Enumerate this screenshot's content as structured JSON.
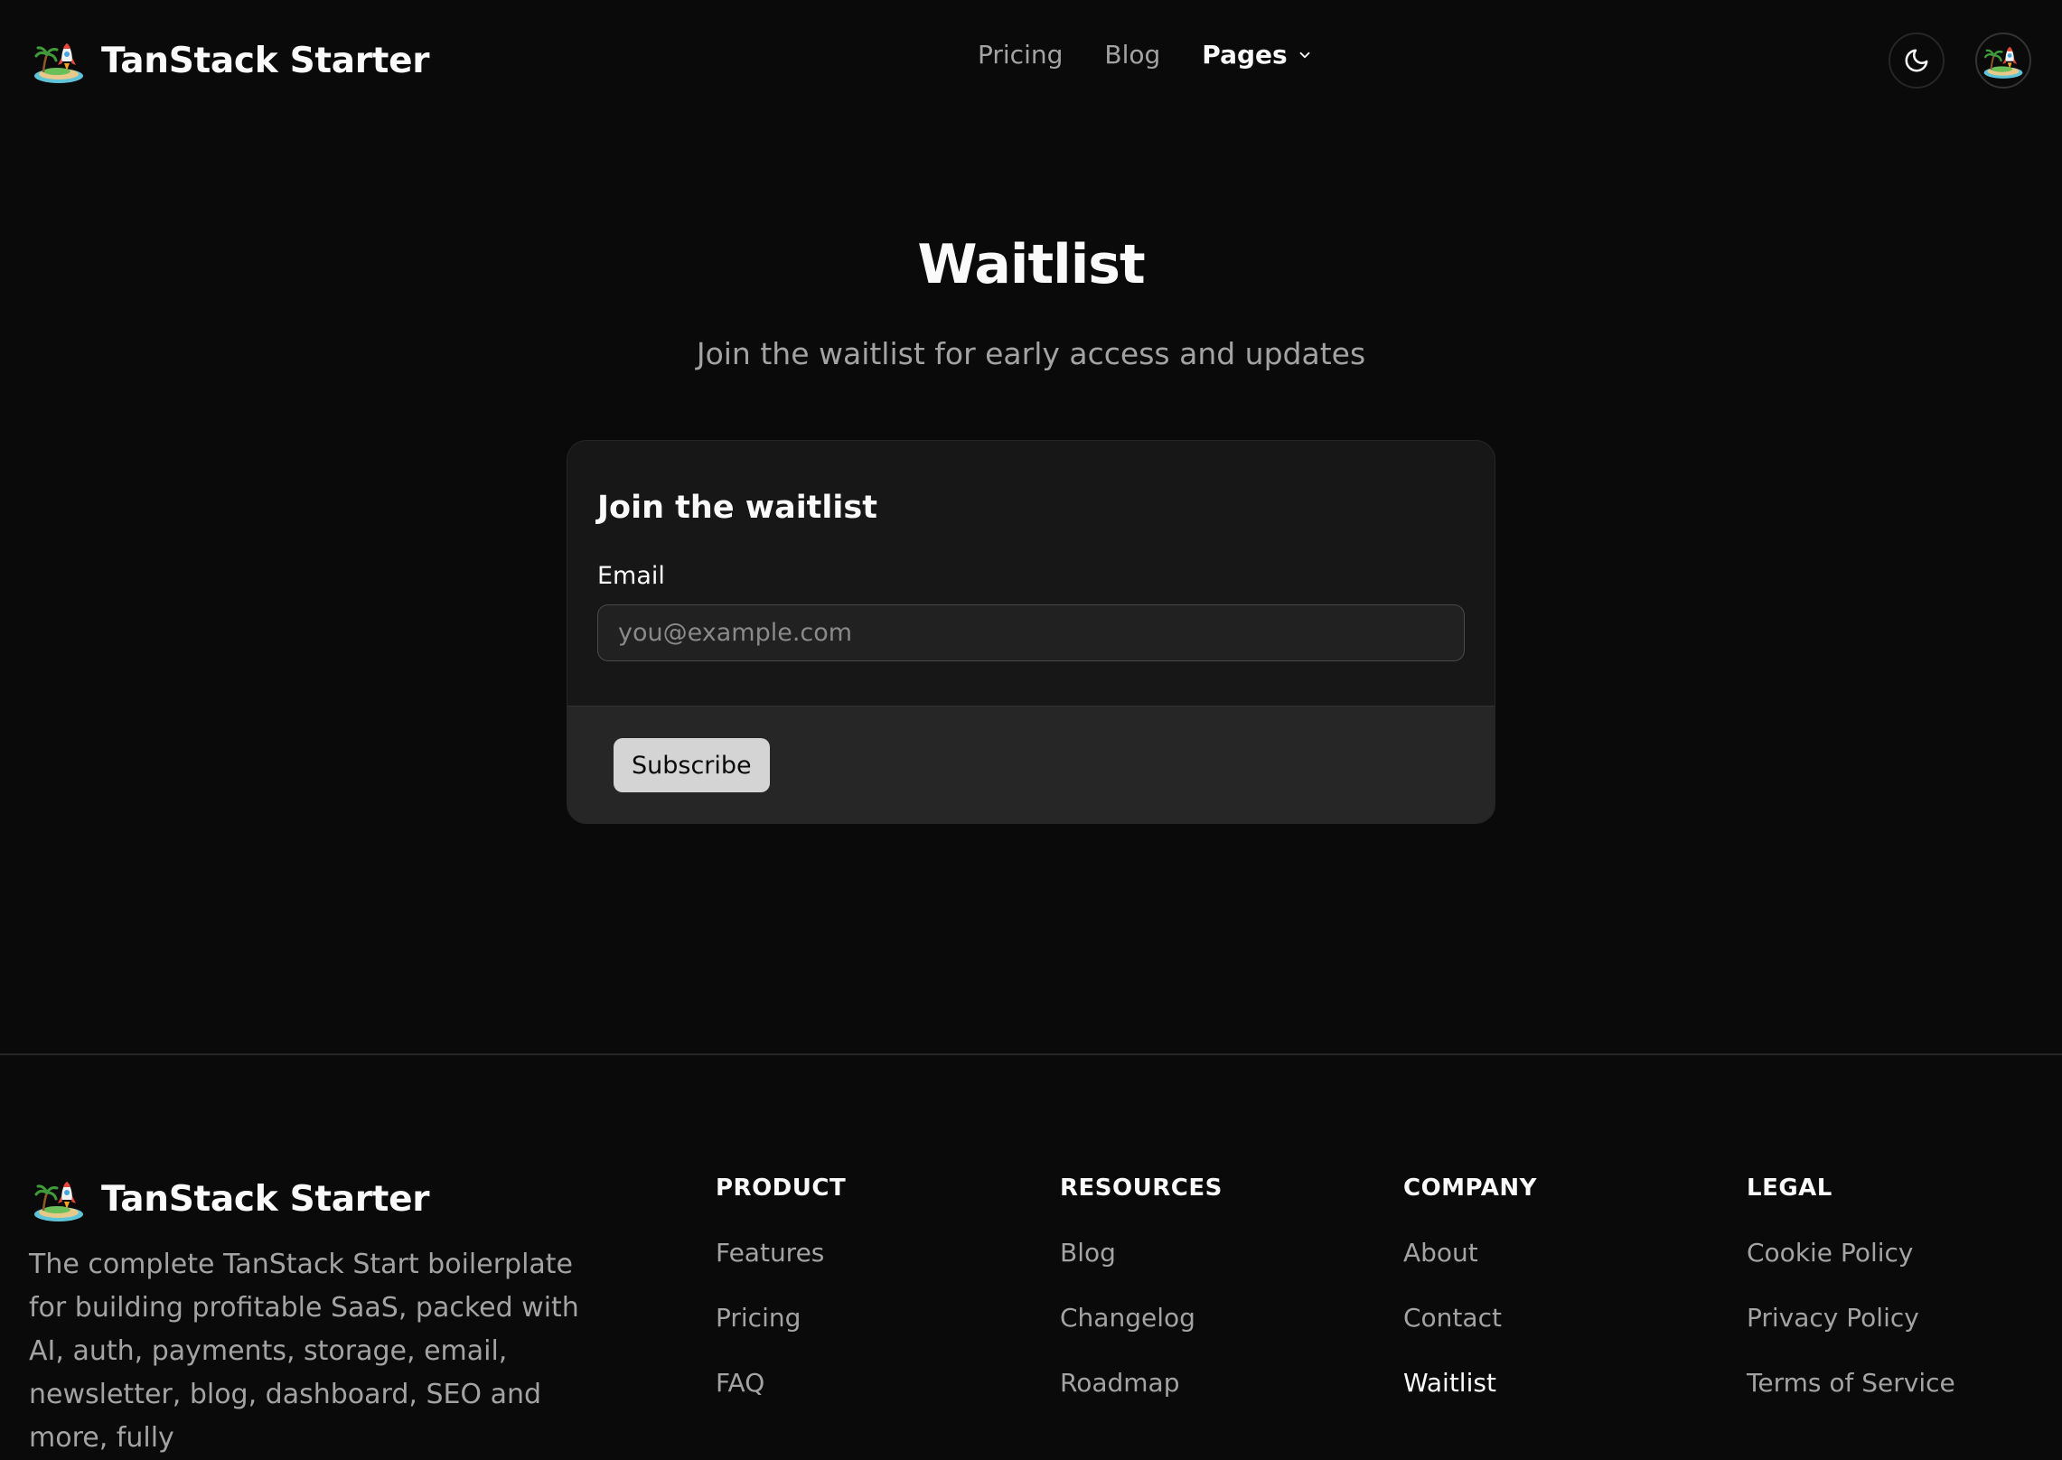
{
  "header": {
    "brand": "TanStack Starter",
    "nav": [
      {
        "label": "Pricing"
      },
      {
        "label": "Blog"
      },
      {
        "label": "Pages"
      }
    ]
  },
  "hero": {
    "title": "Waitlist",
    "subtitle": "Join the waitlist for early access and updates"
  },
  "card": {
    "title": "Join the waitlist",
    "email_label": "Email",
    "email_placeholder": "you@example.com",
    "email_value": "",
    "subscribe_label": "Subscribe"
  },
  "footer": {
    "brand": "TanStack Starter",
    "description": "The complete TanStack Start boilerplate for building profitable SaaS, packed with AI, auth, payments, storage, email, newsletter, blog, dashboard, SEO and more, fully",
    "columns": [
      {
        "title": "PRODUCT",
        "links": [
          "Features",
          "Pricing",
          "FAQ"
        ]
      },
      {
        "title": "RESOURCES",
        "links": [
          "Blog",
          "Changelog",
          "Roadmap"
        ]
      },
      {
        "title": "COMPANY",
        "links": [
          "About",
          "Contact",
          "Waitlist"
        ]
      },
      {
        "title": "LEGAL",
        "links": [
          "Cookie Policy",
          "Privacy Policy",
          "Terms of Service"
        ]
      }
    ]
  },
  "icons": {
    "logo": "island-rocket-icon",
    "theme": "moon-icon",
    "dropdown": "chevron-down-icon"
  }
}
